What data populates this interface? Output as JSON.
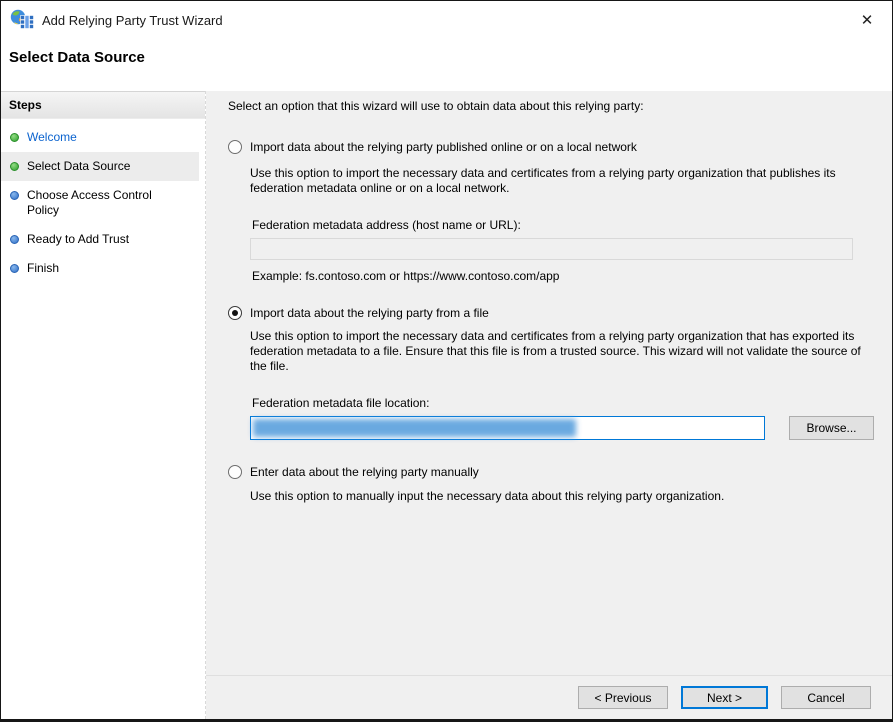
{
  "window": {
    "title": "Add Relying Party Trust Wizard",
    "close_glyph": "✕"
  },
  "page": {
    "heading": "Select Data Source"
  },
  "sidebar": {
    "header": "Steps",
    "items": [
      {
        "label": "Welcome",
        "state": "done",
        "current": false
      },
      {
        "label": "Select Data Source",
        "state": "done",
        "current": true
      },
      {
        "label": "Choose Access Control Policy",
        "state": "todo",
        "current": false
      },
      {
        "label": "Ready to Add Trust",
        "state": "todo",
        "current": false
      },
      {
        "label": "Finish",
        "state": "todo",
        "current": false
      }
    ]
  },
  "main": {
    "intro": "Select an option that this wizard will use to obtain data about this relying party:",
    "option1": {
      "label": "Import data about the relying party published online or on a local network",
      "selected": false,
      "desc": "Use this option to import the necessary data and certificates from a relying party organization that publishes its federation metadata online or on a local network.",
      "field_label": "Federation metadata address (host name or URL):",
      "field_value": "",
      "example": "Example: fs.contoso.com or https://www.contoso.com/app"
    },
    "option2": {
      "label": "Import data about the relying party from a file",
      "selected": true,
      "desc": "Use this option to import the necessary data and certificates from a relying party organization that has exported its federation metadata to a file. Ensure that this file is from a trusted source.  This wizard will not validate the source of the file.",
      "field_label": "Federation metadata file location:",
      "field_value": "",
      "field_value_redacted": true,
      "browse_label": "Browse..."
    },
    "option3": {
      "label": "Enter data about the relying party manually",
      "selected": false,
      "desc": "Use this option to manually input the necessary data about this relying party organization."
    }
  },
  "footer": {
    "previous": "< Previous",
    "next": "Next >",
    "cancel": "Cancel"
  },
  "colors": {
    "accent": "#0078d7",
    "step_done": "#2da02d",
    "step_todo": "#2f6fc8",
    "link": "#0b63ce",
    "redaction": "#5aa0dd",
    "main_background": "#f0f0f0"
  }
}
